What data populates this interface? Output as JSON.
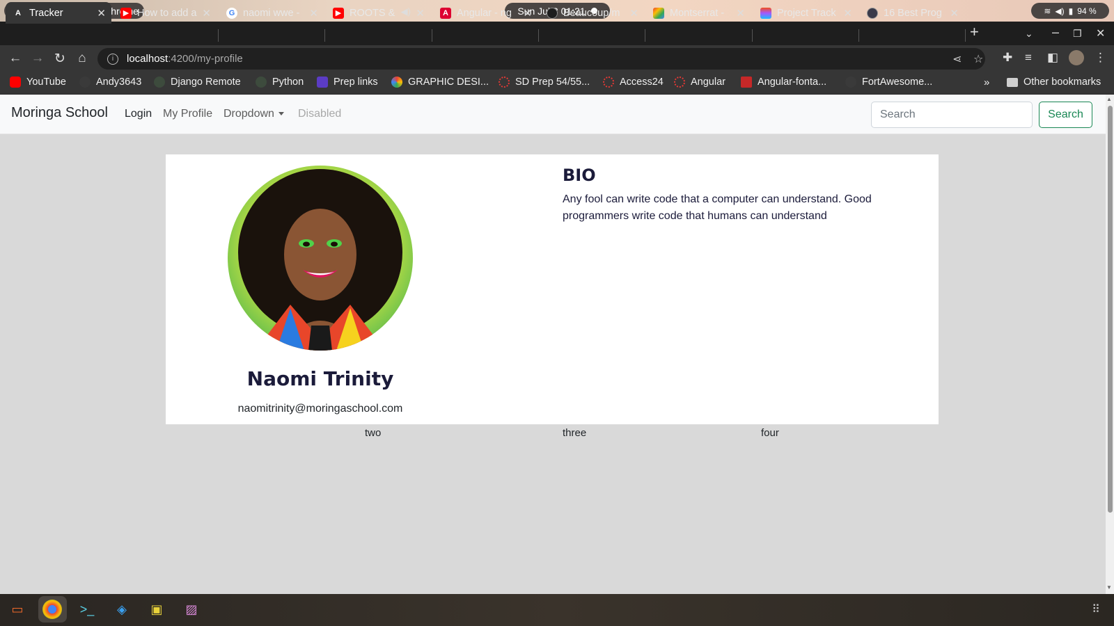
{
  "os": {
    "app_name": "Google Chrome",
    "clock": "Sun Jul 3  01:21",
    "battery": "94 %"
  },
  "tabs": [
    {
      "label": "Tracker",
      "icon": "angular-icon",
      "active": true
    },
    {
      "label": "How to add a",
      "icon": "youtube-icon"
    },
    {
      "label": "naomi wwe -",
      "icon": "google-icon"
    },
    {
      "label": "ROOTS &",
      "icon": "youtube-icon"
    },
    {
      "label": "Angular - ng",
      "icon": "angular-icon"
    },
    {
      "label": "Beaucoup/m",
      "icon": "github-icon"
    },
    {
      "label": "Montserrat -",
      "icon": "google-fonts-icon"
    },
    {
      "label": "Project Track",
      "icon": "figma-icon"
    },
    {
      "label": "16 Best Prog",
      "icon": "web-icon"
    }
  ],
  "address": {
    "host": "localhost",
    "path": ":4200/my-profile"
  },
  "bookmarks": [
    {
      "label": "YouTube",
      "icon": "youtube-icon"
    },
    {
      "label": "Andy3643",
      "icon": "github-icon"
    },
    {
      "label": "Django Remote",
      "icon": "django-icon"
    },
    {
      "label": "Python",
      "icon": "python-icon"
    },
    {
      "label": "Prep links",
      "icon": "trello-icon"
    },
    {
      "label": "GRAPHIC DESI...",
      "icon": "pinwheel-icon"
    },
    {
      "label": "SD Prep 54/55...",
      "icon": "circle-icon"
    },
    {
      "label": "Access24",
      "icon": "circle-icon"
    },
    {
      "label": "Angular",
      "icon": "circle-icon"
    },
    {
      "label": "Angular-fonta...",
      "icon": "box-icon"
    },
    {
      "label": "FortAwesome...",
      "icon": "github-icon"
    },
    {
      "label": "Other bookmarks",
      "icon": "folder-icon"
    }
  ],
  "navbar": {
    "brand": "Moringa School",
    "links": [
      "Login",
      "My Profile",
      "Dropdown",
      "Disabled"
    ],
    "search_placeholder": "Search",
    "search_button": "Search"
  },
  "profile": {
    "name": "Naomi Trinity",
    "email": "naomitrinity@moringaschool.com",
    "bio_title": "BIO",
    "bio_text": "Any fool can write code that a computer can understand. Good programmers write code that humans can understand"
  },
  "columns": [
    "two",
    "three",
    "four"
  ],
  "colors": {
    "accent_green": "#198754",
    "heading_navy": "#1b1b3a",
    "page_bg": "#d9d9d9"
  }
}
